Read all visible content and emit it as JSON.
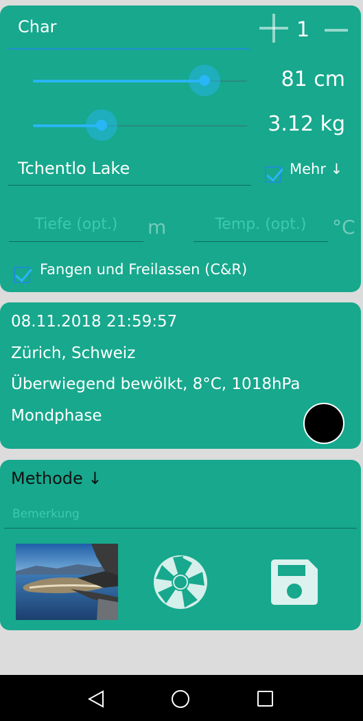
{
  "catch": {
    "species": "Char",
    "count": "1",
    "length_value": "81 cm",
    "length_fraction": 0.8,
    "weight_value": "3.12 kg",
    "weight_fraction": 0.32,
    "water": "Tchentlo Lake",
    "more_label": "Mehr ↓",
    "more_checked": true,
    "depth_placeholder": "Tiefe (opt.)",
    "depth_unit": "m",
    "temp_placeholder": "Temp. (opt.)",
    "temp_unit": "°C",
    "catch_release_label": "Fangen und Freilassen (C&R)",
    "catch_release_checked": true
  },
  "info": {
    "datetime": "08.11.2018 21:59:57",
    "location": "Zürich, Schweiz",
    "weather": "Überwiegend bewölkt, 8°C, 1018hPa",
    "moon_label": "Mondphase",
    "moon_icon": "new-moon-icon"
  },
  "method": {
    "label": "Methode ↓",
    "remark_placeholder": "Bemerkung"
  },
  "icons": {
    "plus": "plus-icon",
    "minus": "minus-icon",
    "camera": "camera-shutter-icon",
    "save": "floppy-disk-icon",
    "back": "back-icon",
    "home": "home-icon",
    "recent": "recent-apps-icon"
  },
  "colors": {
    "card": "#17a88d",
    "accent": "#29b6f6",
    "background": "#dcdcdc"
  }
}
